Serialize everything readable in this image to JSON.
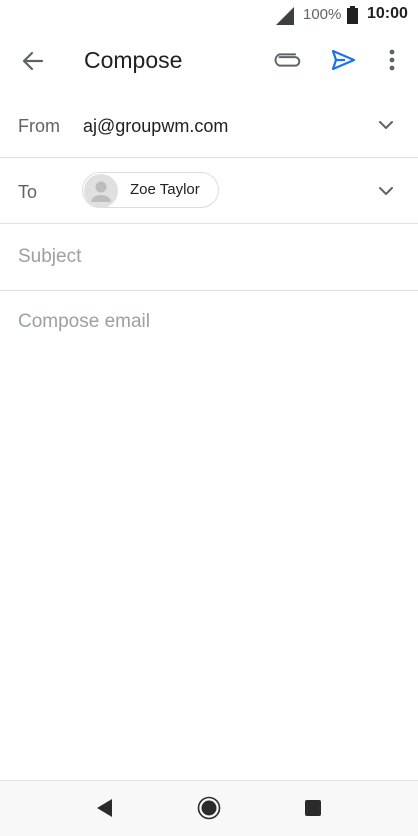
{
  "status_bar": {
    "battery_percent": "100%",
    "time": "10:00",
    "icons": [
      "signal-icon",
      "battery-icon"
    ]
  },
  "toolbar": {
    "title": "Compose",
    "icons": [
      "back-arrow-icon",
      "paperclip-icon",
      "send-icon",
      "more-vert-icon"
    ],
    "accent_color": "#1a73e8"
  },
  "from": {
    "label": "From",
    "value": "aj@groupwm.com"
  },
  "to": {
    "label": "To",
    "recipient_name": "Zoe Taylor"
  },
  "subject": {
    "placeholder": "Subject"
  },
  "body": {
    "placeholder": "Compose email"
  },
  "nav_bar": {
    "icons": [
      "nav-back-icon",
      "nav-home-icon",
      "nav-recents-icon"
    ]
  }
}
